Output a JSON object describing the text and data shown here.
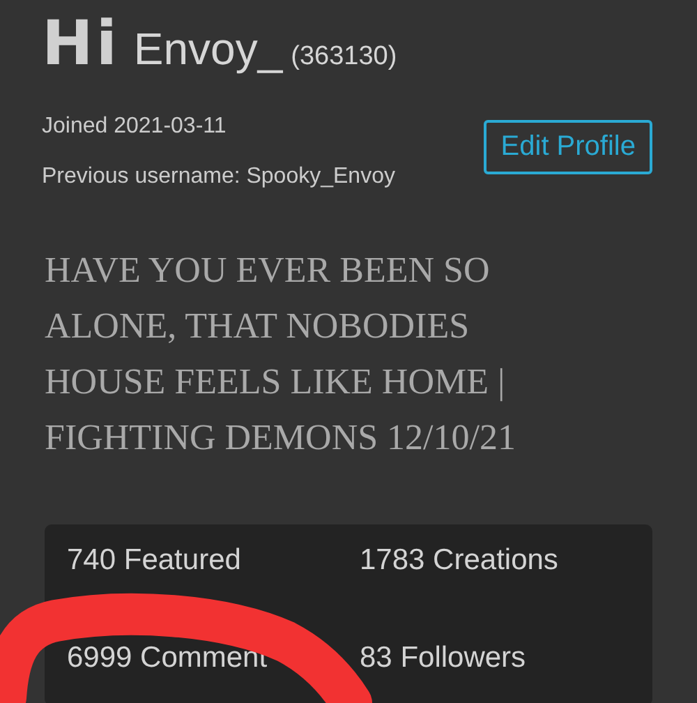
{
  "profile": {
    "logo": "Hi",
    "username": "Envoy_",
    "points": "(363130)",
    "joined": "Joined 2021-03-11",
    "previous_username": "Previous username: Spooky_Envoy",
    "edit_button": "Edit Profile"
  },
  "bio_lines": [
    "HAVE YOU EVER BEEN SO",
    "ALONE, THAT NOBODIES",
    "HOUSE FEELS LIKE HOME |",
    "FIGHTING DEMONS 12/10/21"
  ],
  "stats": [
    "740 Featured",
    "1783 Creations",
    "6999 Comment",
    "83 Followers"
  ],
  "annotation": {
    "kind": "stroke"
  }
}
